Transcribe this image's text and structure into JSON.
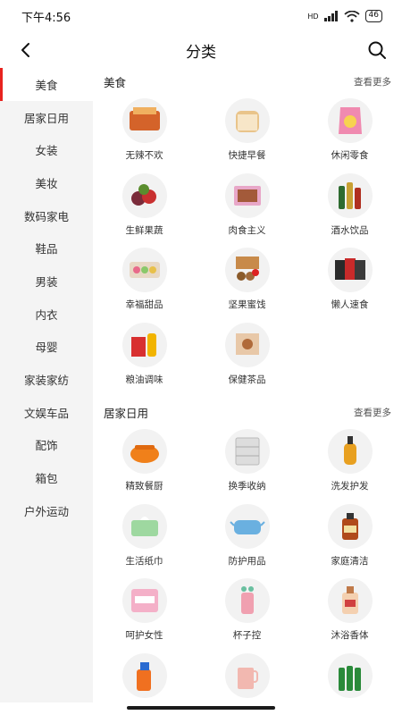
{
  "status": {
    "time": "下午4:56",
    "signal_label": "HD",
    "battery": "46"
  },
  "header": {
    "title": "分类"
  },
  "colors": {
    "accent": "#e8231f",
    "sidebar_bg": "#f4f4f4"
  },
  "sidebar": {
    "items": [
      {
        "label": "美食",
        "active": true
      },
      {
        "label": "居家日用"
      },
      {
        "label": "女装"
      },
      {
        "label": "美妆"
      },
      {
        "label": "数码家电"
      },
      {
        "label": "鞋品"
      },
      {
        "label": "男装"
      },
      {
        "label": "内衣"
      },
      {
        "label": "母婴"
      },
      {
        "label": "家装家纺"
      },
      {
        "label": "文娱车品"
      },
      {
        "label": "配饰"
      },
      {
        "label": "箱包"
      },
      {
        "label": "户外运动"
      }
    ]
  },
  "sections": [
    {
      "title": "美食",
      "more": "查看更多",
      "items": [
        {
          "label": "无辣不欢",
          "icon": "spicy-snack-icon"
        },
        {
          "label": "快捷早餐",
          "icon": "bread-icon"
        },
        {
          "label": "休闲零食",
          "icon": "snack-bag-icon"
        },
        {
          "label": "生鲜果蔬",
          "icon": "fruit-icon"
        },
        {
          "label": "肉食主义",
          "icon": "meat-box-icon"
        },
        {
          "label": "酒水饮品",
          "icon": "bottles-icon"
        },
        {
          "label": "幸福甜品",
          "icon": "macaron-icon"
        },
        {
          "label": "坚果蜜饯",
          "icon": "nuts-icon"
        },
        {
          "label": "懒人速食",
          "icon": "noodle-bags-icon"
        },
        {
          "label": "粮油调味",
          "icon": "oil-rice-icon"
        },
        {
          "label": "保健茶品",
          "icon": "tea-icon"
        }
      ]
    },
    {
      "title": "居家日用",
      "more": "查看更多",
      "items": [
        {
          "label": "精致餐厨",
          "icon": "pot-icon"
        },
        {
          "label": "换季收纳",
          "icon": "drawer-icon"
        },
        {
          "label": "洗发护发",
          "icon": "shampoo-icon"
        },
        {
          "label": "生活纸巾",
          "icon": "tissue-icon"
        },
        {
          "label": "防护用品",
          "icon": "mask-icon"
        },
        {
          "label": "家庭清洁",
          "icon": "disinfectant-icon"
        },
        {
          "label": "呵护女性",
          "icon": "pad-pack-icon"
        },
        {
          "label": "杯子控",
          "icon": "cup-icon"
        },
        {
          "label": "沐浴香体",
          "icon": "bodywash-icon"
        },
        {
          "label": "",
          "icon": "spray-bottle-icon"
        },
        {
          "label": "",
          "icon": "mug-icon"
        },
        {
          "label": "",
          "icon": "beer-bottles-icon"
        }
      ]
    }
  ]
}
